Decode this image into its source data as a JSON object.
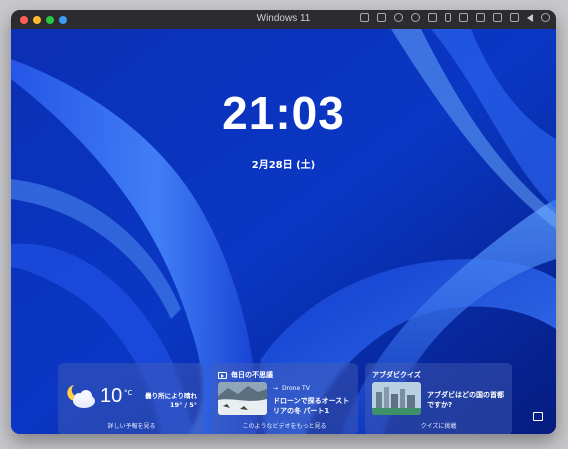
{
  "window": {
    "title": "Windows 11"
  },
  "lockscreen": {
    "time": "21:03",
    "date": "2月28日 (土)"
  },
  "weather": {
    "temp": "10",
    "unit": "°C",
    "condition": "曇り所により晴れ",
    "range": "19° / 5°",
    "footer": "詳しい予報を見る"
  },
  "daily": {
    "header": "毎日の不思議",
    "source_arrow": "→",
    "source": "Drone TV",
    "headline": "ドローンで探るオーストリアの冬 パート1",
    "footer": "このようなビデオをもっと見る"
  },
  "quiz": {
    "header": "アブダビクイズ",
    "question": "アブダビはどの国の首都ですか?",
    "footer": "クイズに挑戦"
  },
  "colors": {
    "close": "#ff5f57",
    "minimize": "#febc2e",
    "maximize": "#28c840",
    "extra": "#3b82f6"
  }
}
